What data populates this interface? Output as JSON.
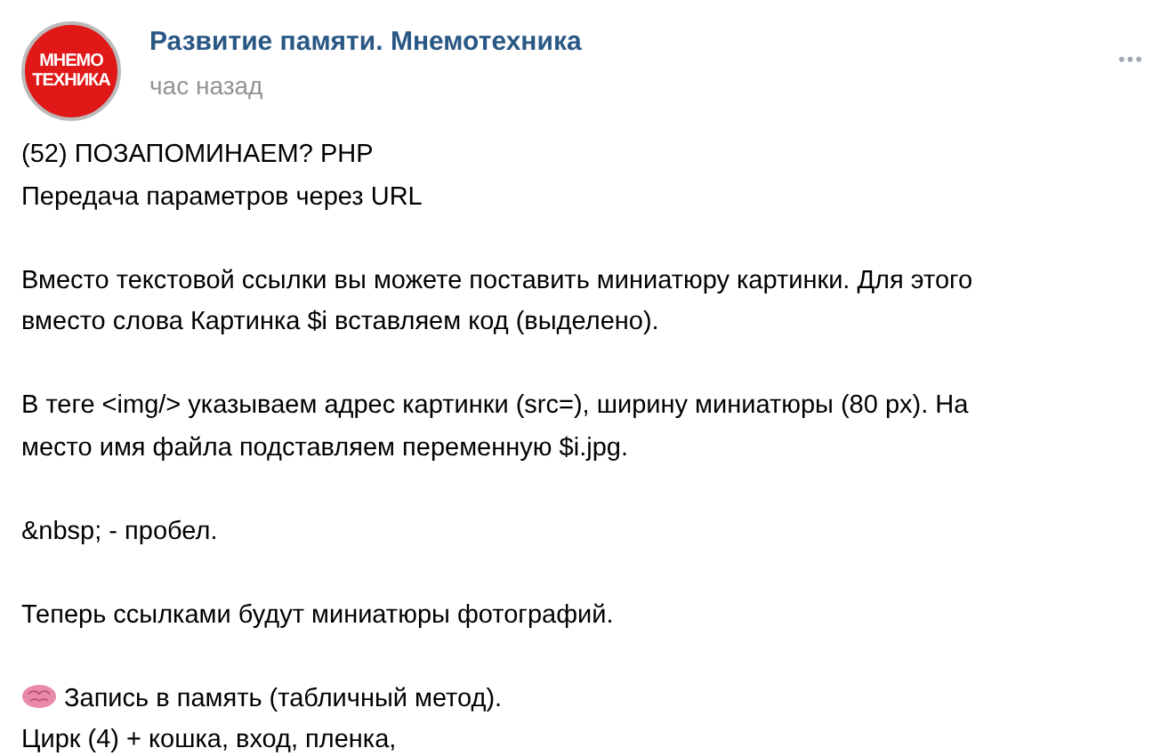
{
  "post": {
    "logo": [
      "МНЕМО",
      "ТЕХНИКА"
    ],
    "author": "Развитие памяти. Мнемотехника",
    "time": "час назад",
    "more": "•••",
    "paragraphs": [
      {
        "lines": [
          "(52) ПОЗАПОМИНАЕМ? PHP",
          "Передача параметров через URL"
        ]
      },
      {
        "lines": [
          "Вместо текстовой ссылки вы можете поставить миниатюру картинки. Для этого",
          "вместо слова Картинка $i вставляем код (выделено)."
        ]
      },
      {
        "lines": [
          "В теге <img/> указываем адрес картинки (src=), ширину миниатюры (80 px). На",
          "место имя файла подставляем переменную $i.jpg."
        ]
      },
      {
        "lines": [
          "&nbsp; - пробел."
        ]
      },
      {
        "lines": [
          "Теперь ссылками будут миниатюры фотографий."
        ]
      },
      {
        "lines": [
          "Запись в память (табличный метод).",
          "Цирк (4) + кошка, вход, пленка,"
        ],
        "kind": "brain"
      }
    ]
  }
}
